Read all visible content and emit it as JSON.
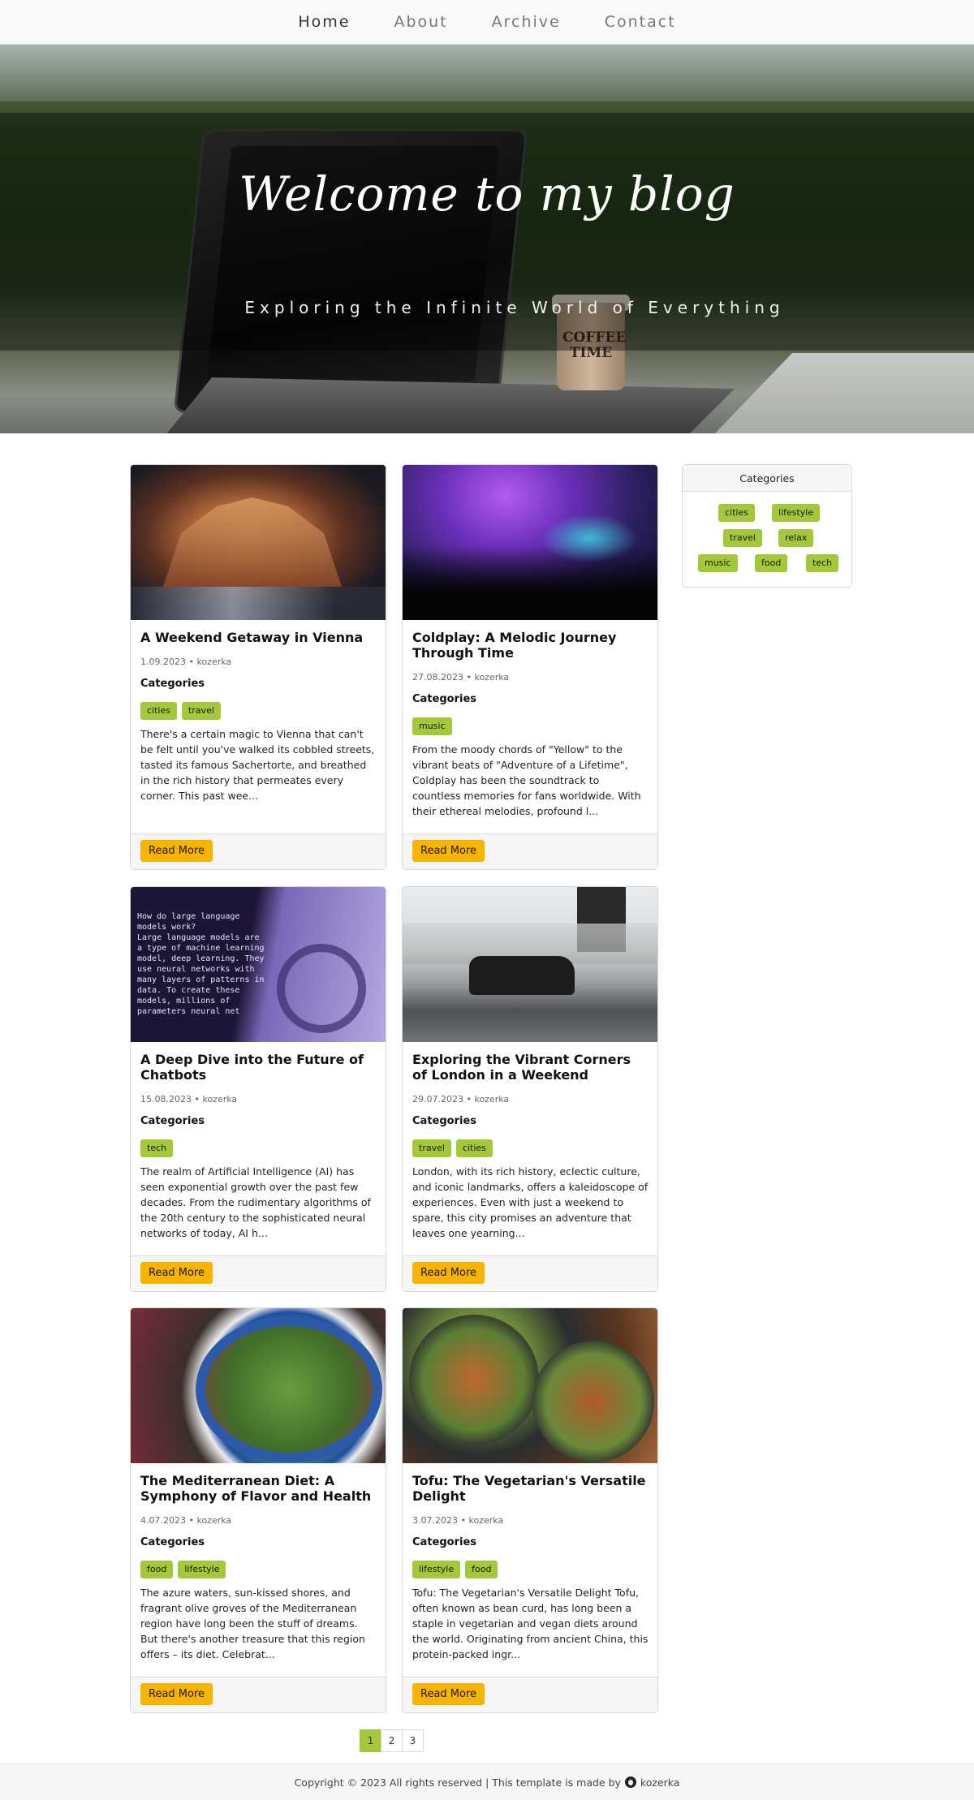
{
  "nav": {
    "items": [
      "Home",
      "About",
      "Archive",
      "Contact"
    ]
  },
  "hero": {
    "title": "Welcome to my blog",
    "subtitle": "Exploring the Infinite World of Everything",
    "cup_text": "COFFEE TIME"
  },
  "posts": [
    {
      "title": "A Weekend Getaway in Vienna",
      "meta": "1.09.2023 • kozerka",
      "categories_heading": "Categories",
      "tags": [
        "cities",
        "travel"
      ],
      "excerpt": "There's a certain magic to Vienna that can't be felt until you've walked its cobbled streets, tasted its famous Sachertorte, and breathed in the rich history that permeates every corner. This past wee...",
      "button": "Read More"
    },
    {
      "title": "Coldplay: A Melodic Journey Through Time",
      "meta": "27.08.2023 • kozerka",
      "categories_heading": "Categories",
      "tags": [
        "music"
      ],
      "excerpt": "From the moody chords of \"Yellow\" to the vibrant beats of \"Adventure of a Lifetime\", Coldplay has been the soundtrack to countless memories for fans worldwide. With their ethereal melodies, profound l...",
      "button": "Read More"
    },
    {
      "title": "A Deep Dive into the Future of Chatbots",
      "meta": "15.08.2023 • kozerka",
      "categories_heading": "Categories",
      "tags": [
        "tech"
      ],
      "excerpt": "The realm of Artificial Intelligence (AI) has seen exponential growth over the past few decades. From the rudimentary algorithms of the 20th century to the sophisticated neural networks of today, AI h...",
      "button": "Read More"
    },
    {
      "title": "Exploring the Vibrant Corners of London in a Weekend",
      "meta": "29.07.2023 • kozerka",
      "categories_heading": "Categories",
      "tags": [
        "travel",
        "cities"
      ],
      "excerpt": "London, with its rich history, eclectic culture, and iconic landmarks, offers a kaleidoscope of experiences. Even with just a weekend to spare, this city promises an adventure that leaves one yearning...",
      "button": "Read More"
    },
    {
      "title": "The Mediterranean Diet: A Symphony of Flavor and Health",
      "meta": "4.07.2023 • kozerka",
      "categories_heading": "Categories",
      "tags": [
        "food",
        "lifestyle"
      ],
      "excerpt": "The azure waters, sun-kissed shores, and fragrant olive groves of the Mediterranean region have long been the stuff of dreams. But there's another treasure that this region offers – its diet. Celebrat...",
      "button": "Read More"
    },
    {
      "title": "Tofu: The Vegetarian's Versatile Delight",
      "meta": "3.07.2023 • kozerka",
      "categories_heading": "Categories",
      "tags": [
        "lifestyle",
        "food"
      ],
      "excerpt": "Tofu: The Vegetarian's Versatile Delight Tofu, often known as bean curd, has long been a staple in vegetarian and vegan diets around the world. Originating from ancient China, this protein-packed ingr...",
      "button": "Read More"
    }
  ],
  "chatbot_screen_text": "How do large language models work?\nLarge language models are a type of machine learning model, deep learning. They use neural networks with many layers of patterns in data. To create these models, millions of parameters neural net",
  "sidebar": {
    "heading": "Categories",
    "tags": [
      "cities",
      "lifestyle",
      "travel",
      "relax",
      "music",
      "food",
      "tech"
    ]
  },
  "pagination": {
    "pages": [
      "1",
      "2",
      "3"
    ],
    "current": "1"
  },
  "footer": {
    "text": "Copyright © 2023 All rights reserved | This template is made by",
    "author": "kozerka"
  },
  "colors": {
    "tag": "#a3c93a",
    "button": "#f8b400",
    "nav_bg": "#f8f9fa"
  }
}
